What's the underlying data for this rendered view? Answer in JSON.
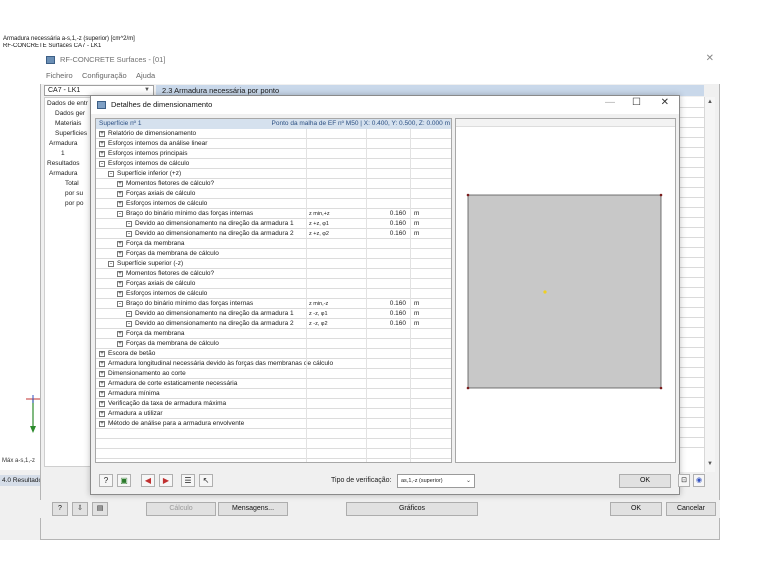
{
  "background": {
    "title_line": "Armadura necessária a-s,1,-z (superior) [cm^2/m]",
    "subtitle_line": "RF-CONCRETE Surfaces CA7 - LK1",
    "max_label": "Máx a-s,1,-z",
    "results_label": "4.0 Resultados"
  },
  "main_window": {
    "title": "RF-CONCRETE Surfaces - [01]",
    "menu": [
      "Ficheiro",
      "Configuração",
      "Ajuda"
    ],
    "combo_value": "CA7 - LK1",
    "section_header": "2.3 Armadura necessária por ponto",
    "nav": [
      "Dados de entr",
      "Dados ger",
      "Materiais",
      "Superficies",
      "Armadura",
      "1",
      "Resultados",
      "Armadura",
      "Total",
      "por su",
      "por po"
    ],
    "buttons": {
      "calc": "Cálculo",
      "messages": "Mensagens...",
      "graphics": "Gráficos",
      "ok": "OK",
      "cancel": "Cancelar"
    }
  },
  "dialog": {
    "title": "Detalhes de dimensionamento",
    "header_left": "Superfície nº 1",
    "header_right": "Ponto da malha de EF nº M50  |  X: 0.400, Y: 0.500, Z: 0.000 m",
    "rows": [
      {
        "level": 0,
        "toggle": "+",
        "label": "Relatório de dimensionamento"
      },
      {
        "level": 0,
        "toggle": "+",
        "label": "Esforços internos da análise linear"
      },
      {
        "level": 0,
        "toggle": "+",
        "label": "Esforços internos principais"
      },
      {
        "level": 0,
        "toggle": "-",
        "label": "Esforços internos de cálculo"
      },
      {
        "level": 1,
        "toggle": "-",
        "label": "Superfície inferior (+z)"
      },
      {
        "level": 2,
        "toggle": "+",
        "label": "Momentos fletores de cálculo?"
      },
      {
        "level": 2,
        "toggle": "+",
        "label": "Forças axiais de cálculo"
      },
      {
        "level": 2,
        "toggle": "+",
        "label": "Esforços internos de cálculo"
      },
      {
        "level": 2,
        "toggle": "-",
        "label": "Braço do binário mínimo das forças internas",
        "sym": "z min,+z",
        "val": "0.160",
        "unit": "m"
      },
      {
        "level": 3,
        "toggle": "-",
        "label": "Devido ao dimensionamento na direção da armadura 1",
        "sym": "z +z, φ1",
        "val": "0.160",
        "unit": "m"
      },
      {
        "level": 3,
        "toggle": "-",
        "label": "Devido ao dimensionamento na direção da armadura 2",
        "sym": "z +z, φ2",
        "val": "0.160",
        "unit": "m"
      },
      {
        "level": 2,
        "toggle": "+",
        "label": "Força da membrana"
      },
      {
        "level": 2,
        "toggle": "+",
        "label": "Forças da membrana de cálculo"
      },
      {
        "level": 1,
        "toggle": "-",
        "label": "Superfície superior (-z)"
      },
      {
        "level": 2,
        "toggle": "+",
        "label": "Momentos fletores de cálculo?"
      },
      {
        "level": 2,
        "toggle": "+",
        "label": "Forças axiais de cálculo"
      },
      {
        "level": 2,
        "toggle": "+",
        "label": "Esforços internos de cálculo"
      },
      {
        "level": 2,
        "toggle": "-",
        "label": "Braço do binário mínimo das forças internas",
        "sym": "z min,-z",
        "val": "0.160",
        "unit": "m"
      },
      {
        "level": 3,
        "toggle": "-",
        "label": "Devido ao dimensionamento na direção da armadura 1",
        "sym": "z -z, φ1",
        "val": "0.160",
        "unit": "m"
      },
      {
        "level": 3,
        "toggle": "-",
        "label": "Devido ao dimensionamento na direção da armadura 2",
        "sym": "z -z, φ2",
        "val": "0.160",
        "unit": "m"
      },
      {
        "level": 2,
        "toggle": "+",
        "label": "Força da membrana"
      },
      {
        "level": 2,
        "toggle": "+",
        "label": "Forças da membrana de cálculo"
      },
      {
        "level": 0,
        "toggle": "+",
        "label": "Escora de betão"
      },
      {
        "level": 0,
        "toggle": "+",
        "label": "Armadura longitudinal necessária devido às forças das membranas de cálculo"
      },
      {
        "level": 0,
        "toggle": "+",
        "label": "Dimensionamento ao corte"
      },
      {
        "level": 0,
        "toggle": "+",
        "label": "Armadura de corte estaticamente necessária"
      },
      {
        "level": 0,
        "toggle": "+",
        "label": "Armadura mínima"
      },
      {
        "level": 0,
        "toggle": "+",
        "label": "Verificação da taxa de armadura máxima"
      },
      {
        "level": 0,
        "toggle": "+",
        "label": "Armadura a utilizar"
      },
      {
        "level": 0,
        "toggle": "+",
        "label": "Método de análise para a armadura envolvente"
      }
    ],
    "verification_label": "Tipo de verificação:",
    "verification_value": "as,1,-z (superior)",
    "ok": "OK",
    "colors": {
      "accent": "#2b4f82",
      "point": "#f0d020",
      "graphic_fill": "#c8c8c8"
    }
  }
}
